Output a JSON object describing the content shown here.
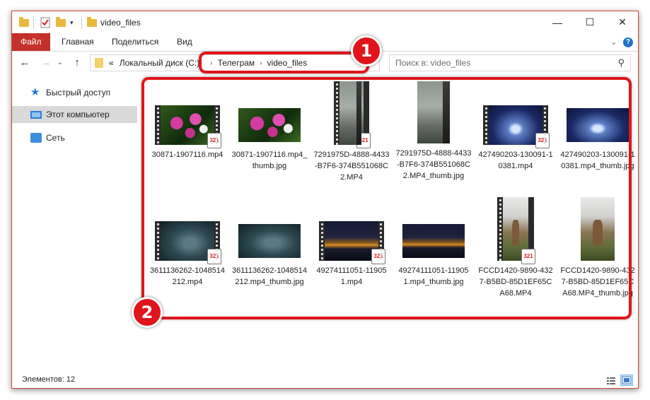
{
  "window": {
    "title": "video_files",
    "controls": {
      "minimize": "—",
      "maximize": "☐",
      "close": "✕"
    }
  },
  "ribbon": {
    "tabs": [
      "Файл",
      "Главная",
      "Поделиться",
      "Вид"
    ],
    "expand_icon": "chevron-down-icon",
    "help_label": "?"
  },
  "address": {
    "overflow": "«",
    "crumbs": [
      "Локальный диск (C:)",
      "Телеграм",
      "video_files"
    ],
    "separator": "›"
  },
  "search": {
    "placeholder": "Поиск в: video_files"
  },
  "nav": {
    "items": [
      {
        "label": "Быстрый доступ",
        "icon": "star-icon"
      },
      {
        "label": "Этот компьютер",
        "icon": "computer-icon",
        "selected": true
      },
      {
        "label": "Сеть",
        "icon": "network-icon"
      }
    ]
  },
  "files": [
    {
      "name": "30871-1907116.mp4",
      "kind": "video",
      "image": "flowers"
    },
    {
      "name": "30871-1907116.mp4_thumb.jpg",
      "kind": "image",
      "image": "flowers"
    },
    {
      "name": "7291975D-4888-4433-B7F6-374B551068C2.MP4",
      "kind": "video",
      "image": "road",
      "portrait": true
    },
    {
      "name": "7291975D-4888-4433-B7F6-374B551068C2.MP4_thumb.jpg",
      "kind": "image",
      "image": "road",
      "portrait": true
    },
    {
      "name": "427490203-130091-10381.mp4",
      "kind": "video",
      "image": "tree"
    },
    {
      "name": "427490203-130091-10381.mp4_thumb.jpg",
      "kind": "image",
      "image": "tree"
    },
    {
      "name": "3611136262-1048514212.mp4",
      "kind": "video",
      "image": "winter"
    },
    {
      "name": "3611136262-1048514212.mp4_thumb.jpg",
      "kind": "image",
      "image": "winter"
    },
    {
      "name": "49274111051-119051.mp4",
      "kind": "video",
      "image": "city"
    },
    {
      "name": "49274111051-119051.mp4_thumb.jpg",
      "kind": "image",
      "image": "city"
    },
    {
      "name": "FCCD1420-9890-4327-B5BD-85D1EF65CA68.MP4",
      "kind": "video",
      "image": "deer",
      "portrait": true
    },
    {
      "name": "FCCD1420-9890-4327-B5BD-85D1EF65CA68.MP4_thumb.jpg",
      "kind": "image",
      "image": "deer",
      "portrait": true
    }
  ],
  "badge_text": "321",
  "status": {
    "text": "Элементов: 12"
  },
  "annotations": [
    "1",
    "2"
  ],
  "colors": {
    "accent": "#c4302b",
    "annotation": "#e0151b"
  }
}
